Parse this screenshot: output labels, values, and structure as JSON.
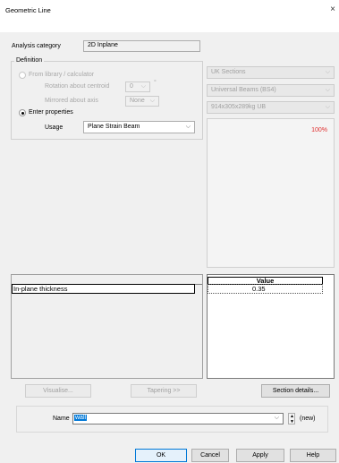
{
  "window": {
    "title": "Geometric Line",
    "close_glyph": "×"
  },
  "analysis": {
    "label": "Analysis category",
    "value": "2D Inplane"
  },
  "definition": {
    "group_label": "Definition",
    "from_library_label": "From library / calculator",
    "rotation_label": "Rotation about centroid",
    "rotation_value": "0",
    "rotation_unit": "°",
    "mirrored_label": "Mirrored about axis",
    "mirrored_value": "None",
    "enter_properties_label": "Enter properties",
    "usage_label": "Usage",
    "usage_value": "Plane Strain Beam"
  },
  "library": {
    "sections": "UK Sections",
    "family": "Universal Beams (BS4)",
    "size": "914x305x289kg UB"
  },
  "preview": {
    "scale": "100%",
    "scale_color": "#e03030"
  },
  "table": {
    "row_label": "In-plane thickness",
    "value_header": "Value",
    "value": "0.35"
  },
  "buttons": {
    "visualise": "Visualise...",
    "tapering": "Tapering >>",
    "section_details": "Section details...",
    "ok": "OK",
    "cancel": "Cancel",
    "apply": "Apply",
    "help": "Help"
  },
  "name_field": {
    "label": "Name",
    "value": "wall",
    "new_label": "(new)"
  }
}
